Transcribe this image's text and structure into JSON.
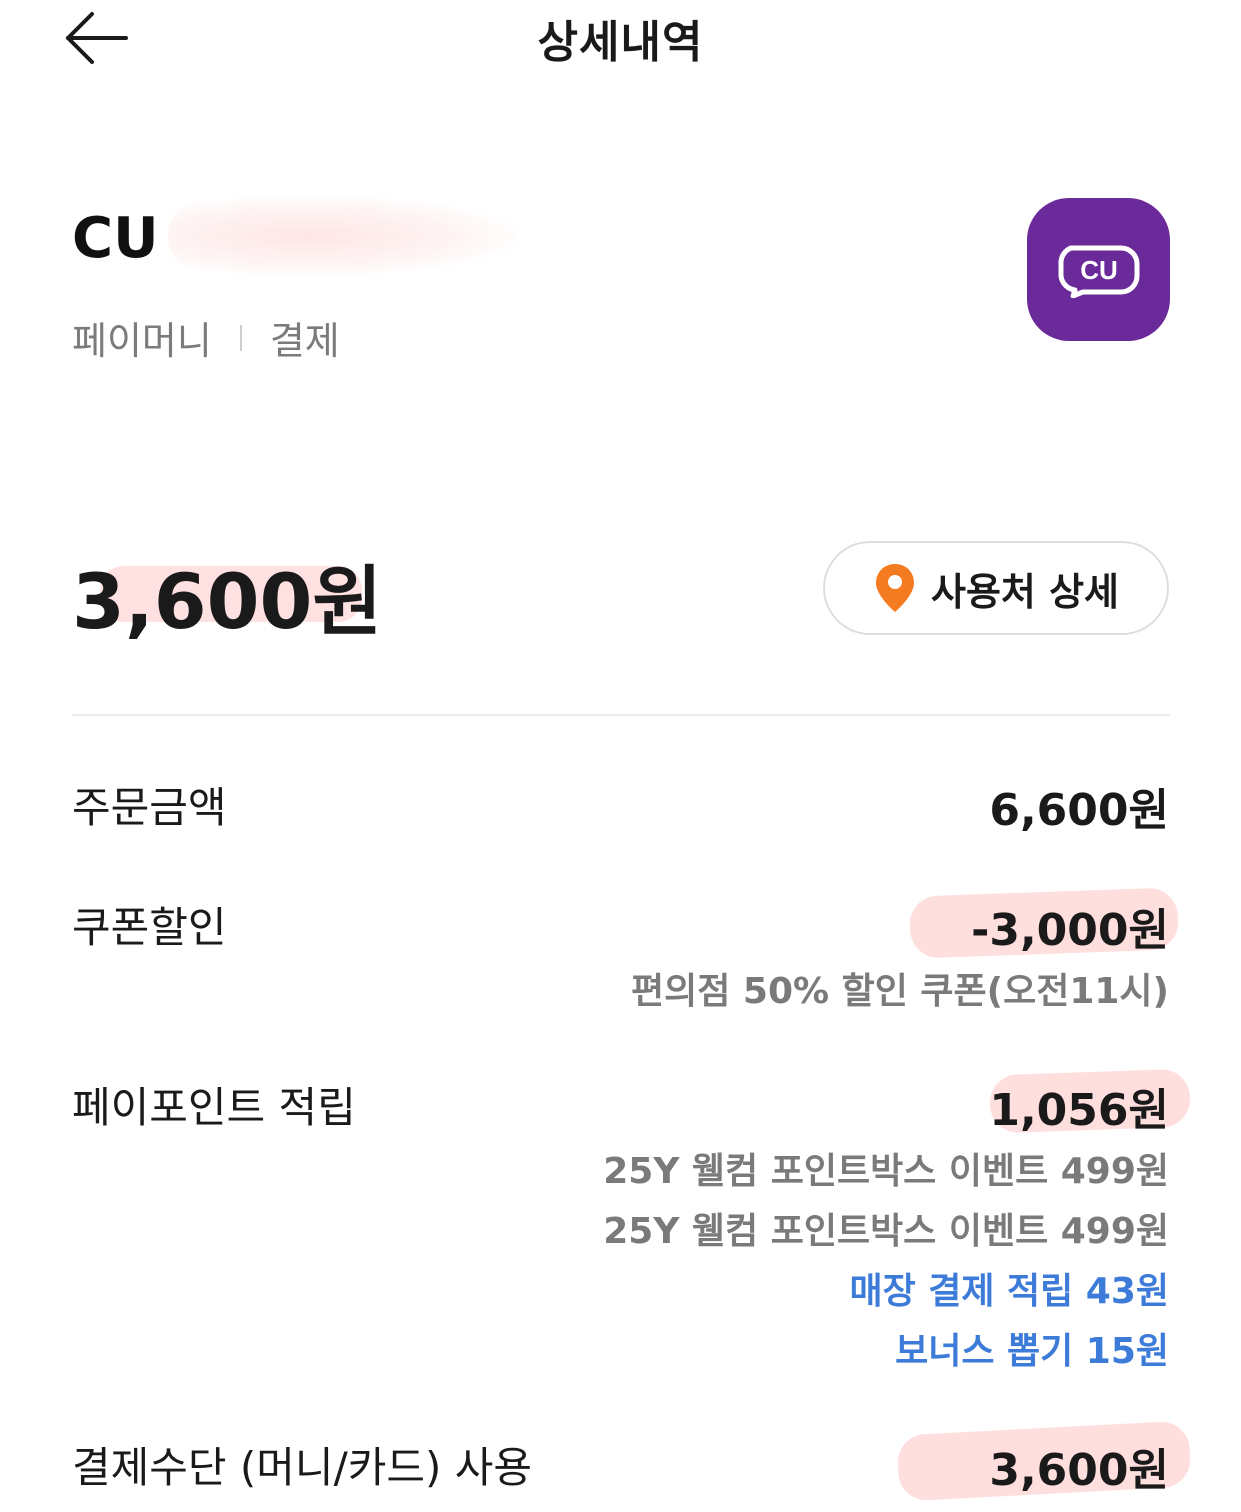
{
  "header": {
    "title": "상세내역"
  },
  "merchant": {
    "name": "CU",
    "method": "페이머니",
    "type": "결제",
    "logo_text": "CU",
    "logo_color": "#6b2a9a"
  },
  "summary": {
    "total": "3,600원",
    "location_button": "사용처 상세",
    "pin_color": "#f47b20"
  },
  "rows": {
    "order": {
      "label": "주문금액",
      "value": "6,600원"
    },
    "coupon": {
      "label": "쿠폰할인",
      "value": "-3,000원",
      "detail": "편의점 50% 할인 쿠폰(오전11시)"
    },
    "points": {
      "label": "페이포인트 적립",
      "value": "1,056원",
      "details": [
        {
          "text": "25Y 웰컴 포인트박스 이벤트 499원"
        },
        {
          "text": "25Y 웰컴 포인트박스 이벤트 499원"
        },
        {
          "text": "매장 결제 적립 43원"
        },
        {
          "text": "보너스 뽑기 15원"
        }
      ]
    },
    "payment": {
      "label": "결제수단 (머니/카드) 사용",
      "value": "3,600원"
    }
  },
  "colors": {
    "accent_blue": "#3d7bd9",
    "muted_gray": "#7a7a7a"
  }
}
